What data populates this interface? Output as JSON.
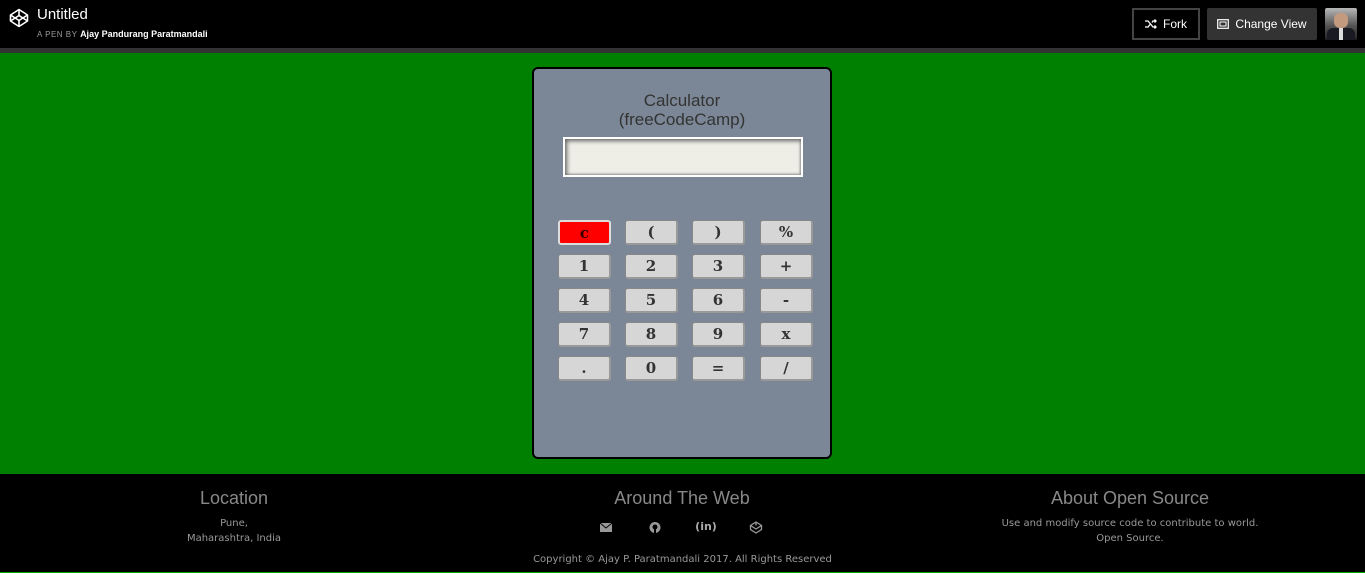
{
  "header": {
    "title": "Untitled",
    "byline_prefix": "A PEN BY",
    "author": "Ajay Pandurang Paratmandali",
    "fork_label": "Fork",
    "change_view_label": "Change View"
  },
  "calculator": {
    "title_line1": "Calculator",
    "title_line2": "(freeCodeCamp)",
    "display_value": "",
    "keys": [
      [
        "c",
        "(",
        ")",
        "%"
      ],
      [
        "1",
        "2",
        "3",
        "+"
      ],
      [
        "4",
        "5",
        "6",
        "-"
      ],
      [
        "7",
        "8",
        "9",
        "x"
      ],
      [
        ".",
        "0",
        "=",
        "/"
      ]
    ]
  },
  "footer": {
    "location_heading": "Location",
    "location_line1": "Pune,",
    "location_line2": "Maharashtra, India",
    "web_heading": "Around The Web",
    "social_icons": [
      "envelope-icon",
      "github-icon",
      "linkedin-icon",
      "codepen-icon"
    ],
    "about_heading": "About Open Source",
    "about_line1": "Use and modify source code to contribute to world.",
    "about_line2": "Open Source.",
    "copyright": "Copyright © Ajay P. Paratmandali 2017. All Rights Reserved"
  },
  "colors": {
    "page_background": "#008000",
    "calculator_body": "#7b8796",
    "clear_key": "#ff0000"
  }
}
